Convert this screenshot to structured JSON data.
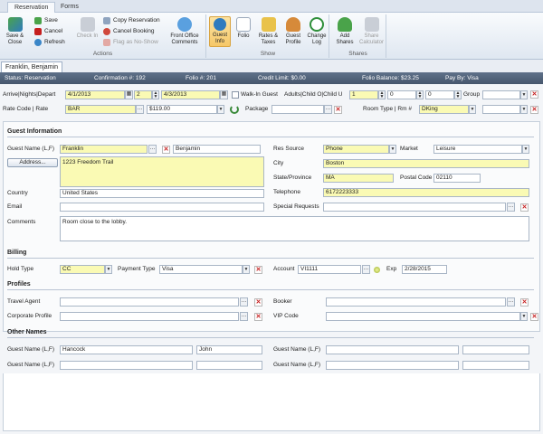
{
  "ribbon": {
    "tabs": [
      "Reservation",
      "Forms"
    ],
    "groups": {
      "actions": "Actions",
      "show": "Show",
      "shares": "Shares"
    },
    "buttons": {
      "save_close": "Save & Close",
      "save": "Save",
      "cancel": "Cancel",
      "refresh": "Refresh",
      "check_in": "Check In",
      "copy_reservation": "Copy Reservation",
      "cancel_booking": "Cancel Booking",
      "flag_no_show": "Flag as No-Show",
      "front_office_comments": "Front Office Comments",
      "guest_info": "Guest Info",
      "folio": "Folio",
      "rates_taxes": "Rates & Taxes",
      "guest_profile": "Guest Profile",
      "change_log": "Change Log",
      "add_shares": "Add Shares",
      "share_calculator": "Share Calculator"
    }
  },
  "doc_tab": "Franklin, Benjamin",
  "status": {
    "status": "Status: Reservation",
    "confirmation": "Confirmation #: 192",
    "folio": "Folio #: 201",
    "credit_limit": "Credit Limit: $0.00",
    "folio_balance": "Folio Balance: $23.25",
    "pay_by": "Pay By: Visa"
  },
  "stay": {
    "label": "Arrive|Nights|Depart",
    "arrive": "4/1/2013",
    "nights": "2",
    "depart": "4/3/2013",
    "walk_in_label": "Walk-In Guest",
    "occupancy_label": "Adults|Child O|Child U",
    "adults": "1",
    "child_o": "0",
    "child_u": "0",
    "group_label": "Group",
    "group_value": "",
    "rate_label": "Rate Code | Rate",
    "rate_code": "BAR",
    "rate": "$119.00",
    "package_label": "Package",
    "package_value": "",
    "room_label": "Room Type | Rm #",
    "room_type": "DKing",
    "room_number": ""
  },
  "guest": {
    "section": "Guest Information",
    "name_label": "Guest Name (L,F)",
    "last_name": "Franklin",
    "first_name": "Benjamin",
    "address_button": "Address...",
    "address": "1223 Freedom Trail",
    "country_label": "Country",
    "country": "United States",
    "email_label": "Email",
    "email": "",
    "comments_label": "Comments",
    "comments": "Room close to the lobby.",
    "res_source_label": "Res Source",
    "res_source": "Phone",
    "market_label": "Market",
    "market": "Leisure",
    "city_label": "City",
    "city": "Boston",
    "state_label": "State/Province",
    "state": "MA",
    "postal_label": "Postal Code",
    "postal": "02110",
    "telephone_label": "Telephone",
    "telephone": "6172223333",
    "special_requests_label": "Special Requests",
    "special_requests": ""
  },
  "billing": {
    "section": "Billing",
    "hold_type_label": "Hold Type",
    "hold_type": "CC",
    "payment_type_label": "Payment Type",
    "payment_type": "Visa",
    "account_label": "Account",
    "account": "VI1111",
    "exp_label": "Exp",
    "exp": "2/28/2015"
  },
  "profiles": {
    "section": "Profiles",
    "travel_agent_label": "Travel Agent",
    "travel_agent": "",
    "corporate_label": "Corporate Profile",
    "corporate": "",
    "booker_label": "Booker",
    "booker": "",
    "vip_label": "VIP Code",
    "vip": ""
  },
  "other_names": {
    "section": "Other Names",
    "label": "Guest Name (L,F)",
    "rows": [
      {
        "last": "Hancock",
        "first": "John",
        "last2": "",
        "first2": ""
      },
      {
        "last": "",
        "first": "",
        "last2": "",
        "first2": ""
      }
    ]
  },
  "colors": {
    "required_field": "#fafab4",
    "status_bar": "#4f6078",
    "selected_button": "#f6c868",
    "delete_red": "#c51f1f"
  }
}
